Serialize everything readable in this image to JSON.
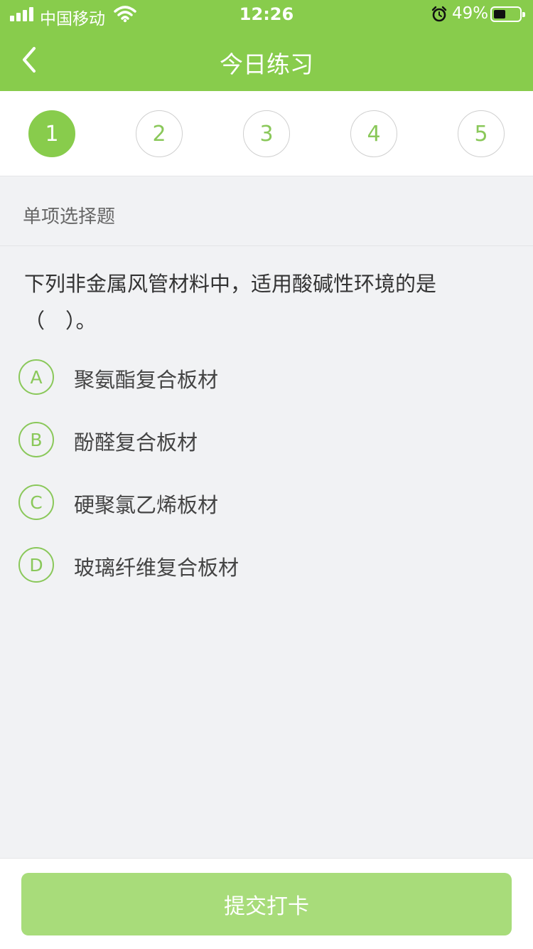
{
  "status_bar": {
    "carrier": "中国移动",
    "time": "12:26",
    "battery_percent": "49%",
    "signal_icon": "signal-bars-icon",
    "wifi_icon": "wifi-icon",
    "alarm_icon": "alarm-clock-icon",
    "battery_icon": "battery-icon"
  },
  "nav": {
    "back_icon": "chevron-left-icon",
    "title": "今日练习"
  },
  "steps": [
    {
      "label": "1",
      "active": true
    },
    {
      "label": "2",
      "active": false
    },
    {
      "label": "3",
      "active": false
    },
    {
      "label": "4",
      "active": false
    },
    {
      "label": "5",
      "active": false
    }
  ],
  "question": {
    "type": "单项选择题",
    "text_line1": "下列非金属风管材料中，适用酸碱性环境的是",
    "text_line2": "（　）。",
    "options": [
      {
        "letter": "A",
        "text": "聚氨酯复合板材"
      },
      {
        "letter": "B",
        "text": "酚醛复合板材"
      },
      {
        "letter": "C",
        "text": "硬聚氯乙烯板材"
      },
      {
        "letter": "D",
        "text": "玻璃纤维复合板材"
      }
    ]
  },
  "footer": {
    "submit_label": "提交打卡"
  },
  "colors": {
    "brand_green": "#88cc4c",
    "submit_disabled_green": "#a8dc7a",
    "background": "#f1f2f4"
  }
}
